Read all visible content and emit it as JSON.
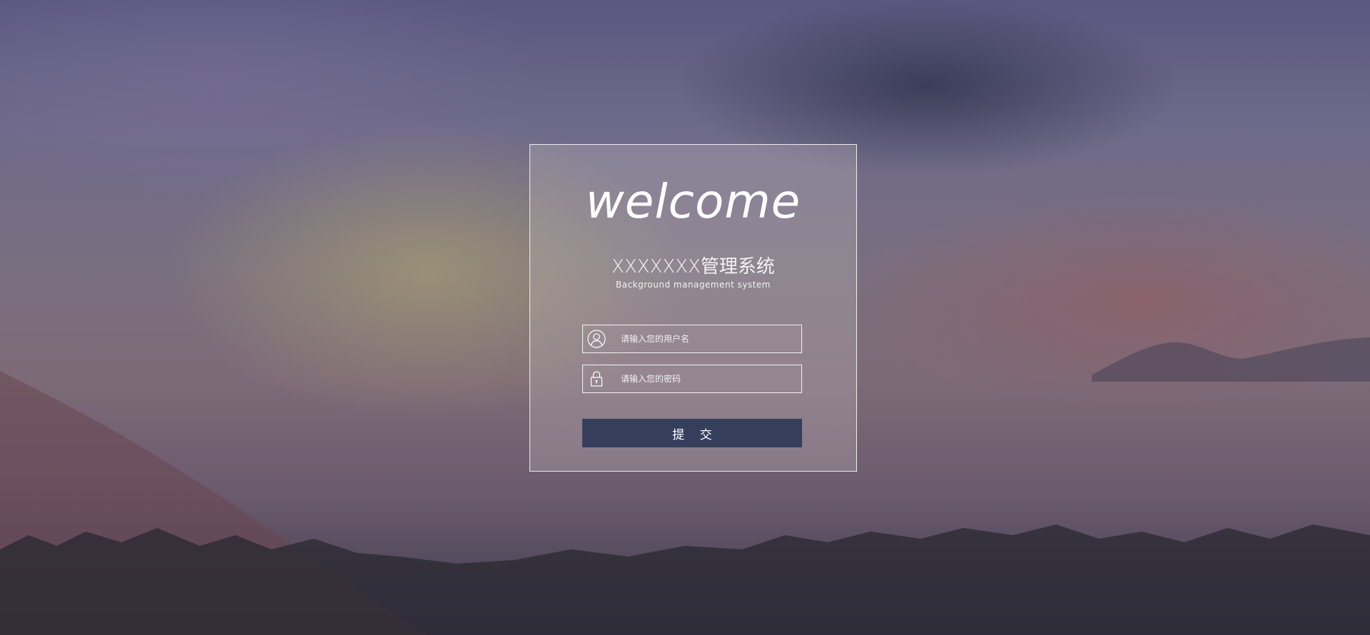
{
  "login": {
    "welcome": "welcome",
    "system_title": "XXXXXXX管理系统",
    "system_subtitle": "Background  management  system",
    "username": {
      "placeholder": "请输入您的用户名",
      "value": "",
      "icon": "user-icon"
    },
    "password": {
      "placeholder": "请输入您的密码",
      "value": "",
      "icon": "lock-icon"
    },
    "submit_label": "提 交"
  },
  "colors": {
    "button": "#353f5b",
    "card_border": "#ffffff",
    "text": "#ffffff"
  }
}
